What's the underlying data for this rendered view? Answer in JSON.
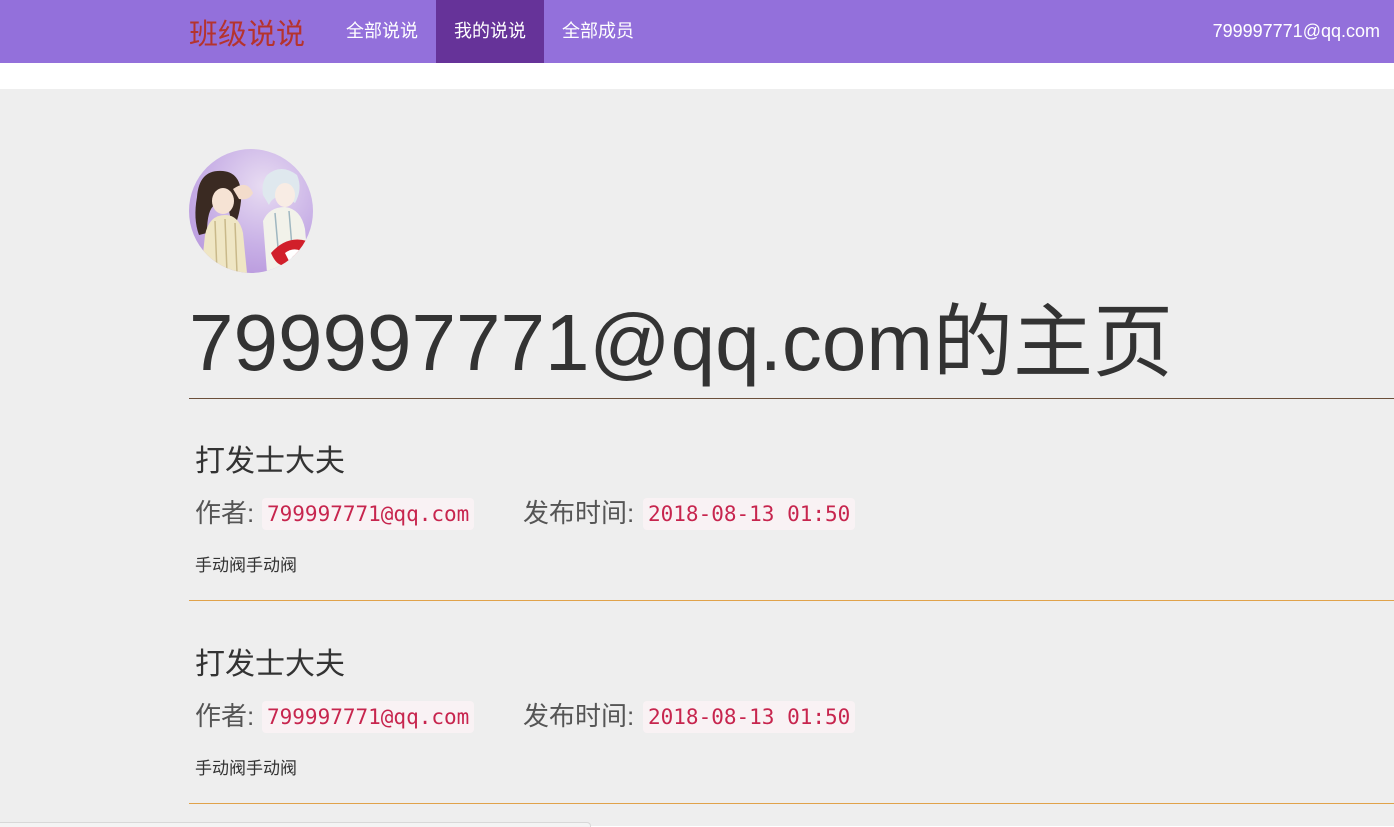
{
  "navbar": {
    "brand": "班级说说",
    "items": [
      {
        "label": "全部说说",
        "active": false
      },
      {
        "label": "我的说说",
        "active": true
      },
      {
        "label": "全部成员",
        "active": false
      }
    ],
    "user_email": "799997771@qq.com",
    "color": "#9370db",
    "active_color": "#663399",
    "brand_color": "#b5332e"
  },
  "profile": {
    "avatar_icon": "anime-avatar-image",
    "title": "799997771@qq.com的主页"
  },
  "posts": [
    {
      "title": "打发士大夫",
      "author_label": "作者:",
      "author": "799997771@qq.com",
      "time_label": "发布时间:",
      "time": "2018-08-13 01:50",
      "content": "手动阀手动阀"
    },
    {
      "title": "打发士大夫",
      "author_label": "作者:",
      "author": "799997771@qq.com",
      "time_label": "发布时间:",
      "time": "2018-08-13 01:50",
      "content": "手动阀手动阀"
    }
  ]
}
